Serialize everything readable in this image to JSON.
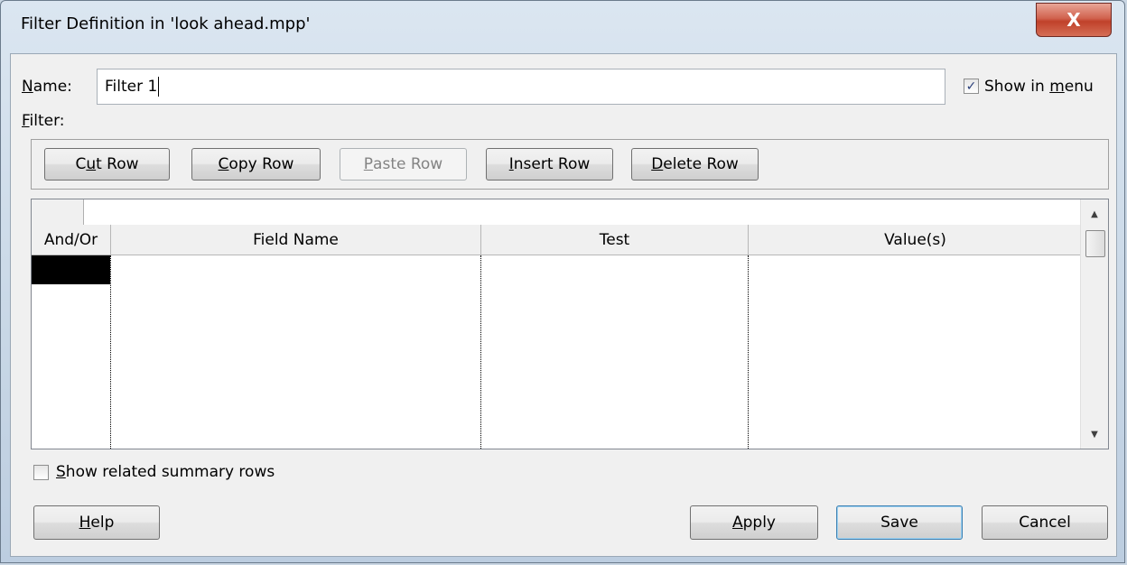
{
  "window": {
    "title": "Filter Definition in 'look ahead.mpp'",
    "close_glyph": "X"
  },
  "name": {
    "label_u": "N",
    "label_rest": "ame:",
    "value": "Filter 1"
  },
  "show_in_menu": {
    "checked": true,
    "label_pre": "Show in ",
    "label_u": "m",
    "label_post": "enu"
  },
  "filter_label": {
    "u": "F",
    "rest": "ilter:"
  },
  "toolbar": {
    "cut": {
      "pre": "C",
      "u": "u",
      "post": "t Row"
    },
    "copy": {
      "pre": "",
      "u": "C",
      "post": "opy Row"
    },
    "paste": {
      "pre": "",
      "u": "P",
      "post": "aste Row"
    },
    "insert": {
      "pre": "",
      "u": "I",
      "post": "nsert Row"
    },
    "delete": {
      "pre": "",
      "u": "D",
      "post": "elete Row"
    }
  },
  "grid": {
    "columns": [
      "And/Or",
      "Field Name",
      "Test",
      "Value(s)"
    ],
    "rows": []
  },
  "summary": {
    "checked": false,
    "u": "S",
    "rest": "how related summary rows"
  },
  "buttons": {
    "help": {
      "u": "H",
      "rest": "elp"
    },
    "apply": {
      "u": "A",
      "rest": "pply"
    },
    "save": "Save",
    "cancel": "Cancel"
  },
  "colors": {
    "accent": "#3c7fb1",
    "close": "#c0412a",
    "selection": "#000000"
  },
  "icons": {
    "close": "close-icon",
    "check": "checkmark-icon",
    "scroll_up": "scroll-up-arrow-icon",
    "scroll_down": "scroll-down-arrow-icon"
  }
}
